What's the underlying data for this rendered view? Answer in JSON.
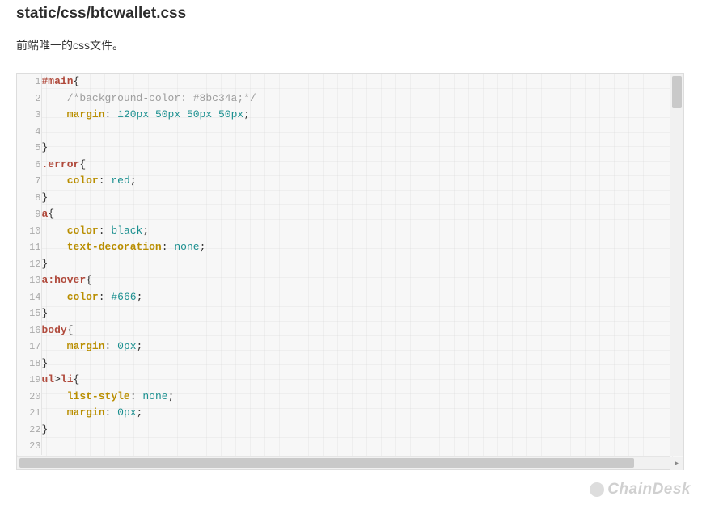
{
  "heading": "static/css/btcwallet.css",
  "description": "前端唯一的css文件。",
  "watermark": "ChainDesk",
  "code": {
    "lines": [
      {
        "n": "1",
        "tokens": [
          {
            "t": "#main",
            "c": "tok-selector"
          },
          {
            "t": "{",
            "c": "tok-punc"
          }
        ]
      },
      {
        "n": "2",
        "tokens": [
          {
            "t": "    ",
            "c": ""
          },
          {
            "t": "/*background-color: #8bc34a;*/",
            "c": "tok-comment"
          }
        ]
      },
      {
        "n": "3",
        "tokens": [
          {
            "t": "    ",
            "c": ""
          },
          {
            "t": "margin",
            "c": "tok-prop"
          },
          {
            "t": ": ",
            "c": "tok-punc"
          },
          {
            "t": "120px 50px 50px 50px",
            "c": "tok-val"
          },
          {
            "t": ";",
            "c": "tok-punc"
          }
        ]
      },
      {
        "n": "4",
        "tokens": [
          {
            "t": "",
            "c": ""
          }
        ]
      },
      {
        "n": "5",
        "tokens": [
          {
            "t": "}",
            "c": "tok-punc"
          }
        ]
      },
      {
        "n": "6",
        "tokens": [
          {
            "t": ".error",
            "c": "tok-selector"
          },
          {
            "t": "{",
            "c": "tok-punc"
          }
        ]
      },
      {
        "n": "7",
        "tokens": [
          {
            "t": "    ",
            "c": ""
          },
          {
            "t": "color",
            "c": "tok-prop"
          },
          {
            "t": ": ",
            "c": "tok-punc"
          },
          {
            "t": "red",
            "c": "tok-val"
          },
          {
            "t": ";",
            "c": "tok-punc"
          }
        ]
      },
      {
        "n": "8",
        "tokens": [
          {
            "t": "}",
            "c": "tok-punc"
          }
        ]
      },
      {
        "n": "9",
        "tokens": [
          {
            "t": "a",
            "c": "tok-selector"
          },
          {
            "t": "{",
            "c": "tok-punc"
          }
        ]
      },
      {
        "n": "10",
        "tokens": [
          {
            "t": "    ",
            "c": ""
          },
          {
            "t": "color",
            "c": "tok-prop"
          },
          {
            "t": ": ",
            "c": "tok-punc"
          },
          {
            "t": "black",
            "c": "tok-val"
          },
          {
            "t": ";",
            "c": "tok-punc"
          }
        ]
      },
      {
        "n": "11",
        "tokens": [
          {
            "t": "    ",
            "c": ""
          },
          {
            "t": "text-decoration",
            "c": "tok-prop"
          },
          {
            "t": ": ",
            "c": "tok-punc"
          },
          {
            "t": "none",
            "c": "tok-val"
          },
          {
            "t": ";",
            "c": "tok-punc"
          }
        ]
      },
      {
        "n": "12",
        "tokens": [
          {
            "t": "}",
            "c": "tok-punc"
          }
        ]
      },
      {
        "n": "13",
        "tokens": [
          {
            "t": "a",
            "c": "tok-selector"
          },
          {
            "t": ":hover",
            "c": "tok-pseudo"
          },
          {
            "t": "{",
            "c": "tok-punc"
          }
        ]
      },
      {
        "n": "14",
        "tokens": [
          {
            "t": "    ",
            "c": ""
          },
          {
            "t": "color",
            "c": "tok-prop"
          },
          {
            "t": ": ",
            "c": "tok-punc"
          },
          {
            "t": "#666",
            "c": "tok-val"
          },
          {
            "t": ";",
            "c": "tok-punc"
          }
        ]
      },
      {
        "n": "15",
        "tokens": [
          {
            "t": "}",
            "c": "tok-punc"
          }
        ]
      },
      {
        "n": "16",
        "tokens": [
          {
            "t": "body",
            "c": "tok-selector"
          },
          {
            "t": "{",
            "c": "tok-punc"
          }
        ]
      },
      {
        "n": "17",
        "tokens": [
          {
            "t": "    ",
            "c": ""
          },
          {
            "t": "margin",
            "c": "tok-prop"
          },
          {
            "t": ": ",
            "c": "tok-punc"
          },
          {
            "t": "0px",
            "c": "tok-val"
          },
          {
            "t": ";",
            "c": "tok-punc"
          }
        ]
      },
      {
        "n": "18",
        "tokens": [
          {
            "t": "}",
            "c": "tok-punc"
          }
        ]
      },
      {
        "n": "19",
        "tokens": [
          {
            "t": "ul",
            "c": "tok-selector"
          },
          {
            "t": ">",
            "c": "tok-punc"
          },
          {
            "t": "li",
            "c": "tok-selector"
          },
          {
            "t": "{",
            "c": "tok-punc"
          }
        ]
      },
      {
        "n": "20",
        "tokens": [
          {
            "t": "    ",
            "c": ""
          },
          {
            "t": "list-style",
            "c": "tok-prop"
          },
          {
            "t": ": ",
            "c": "tok-punc"
          },
          {
            "t": "none",
            "c": "tok-val"
          },
          {
            "t": ";",
            "c": "tok-punc"
          }
        ]
      },
      {
        "n": "21",
        "tokens": [
          {
            "t": "    ",
            "c": ""
          },
          {
            "t": "margin",
            "c": "tok-prop"
          },
          {
            "t": ": ",
            "c": "tok-punc"
          },
          {
            "t": "0px",
            "c": "tok-val"
          },
          {
            "t": ";",
            "c": "tok-punc"
          }
        ]
      },
      {
        "n": "22",
        "tokens": [
          {
            "t": "}",
            "c": "tok-punc"
          }
        ]
      },
      {
        "n": "23",
        "tokens": [
          {
            "t": "",
            "c": ""
          }
        ]
      }
    ]
  }
}
